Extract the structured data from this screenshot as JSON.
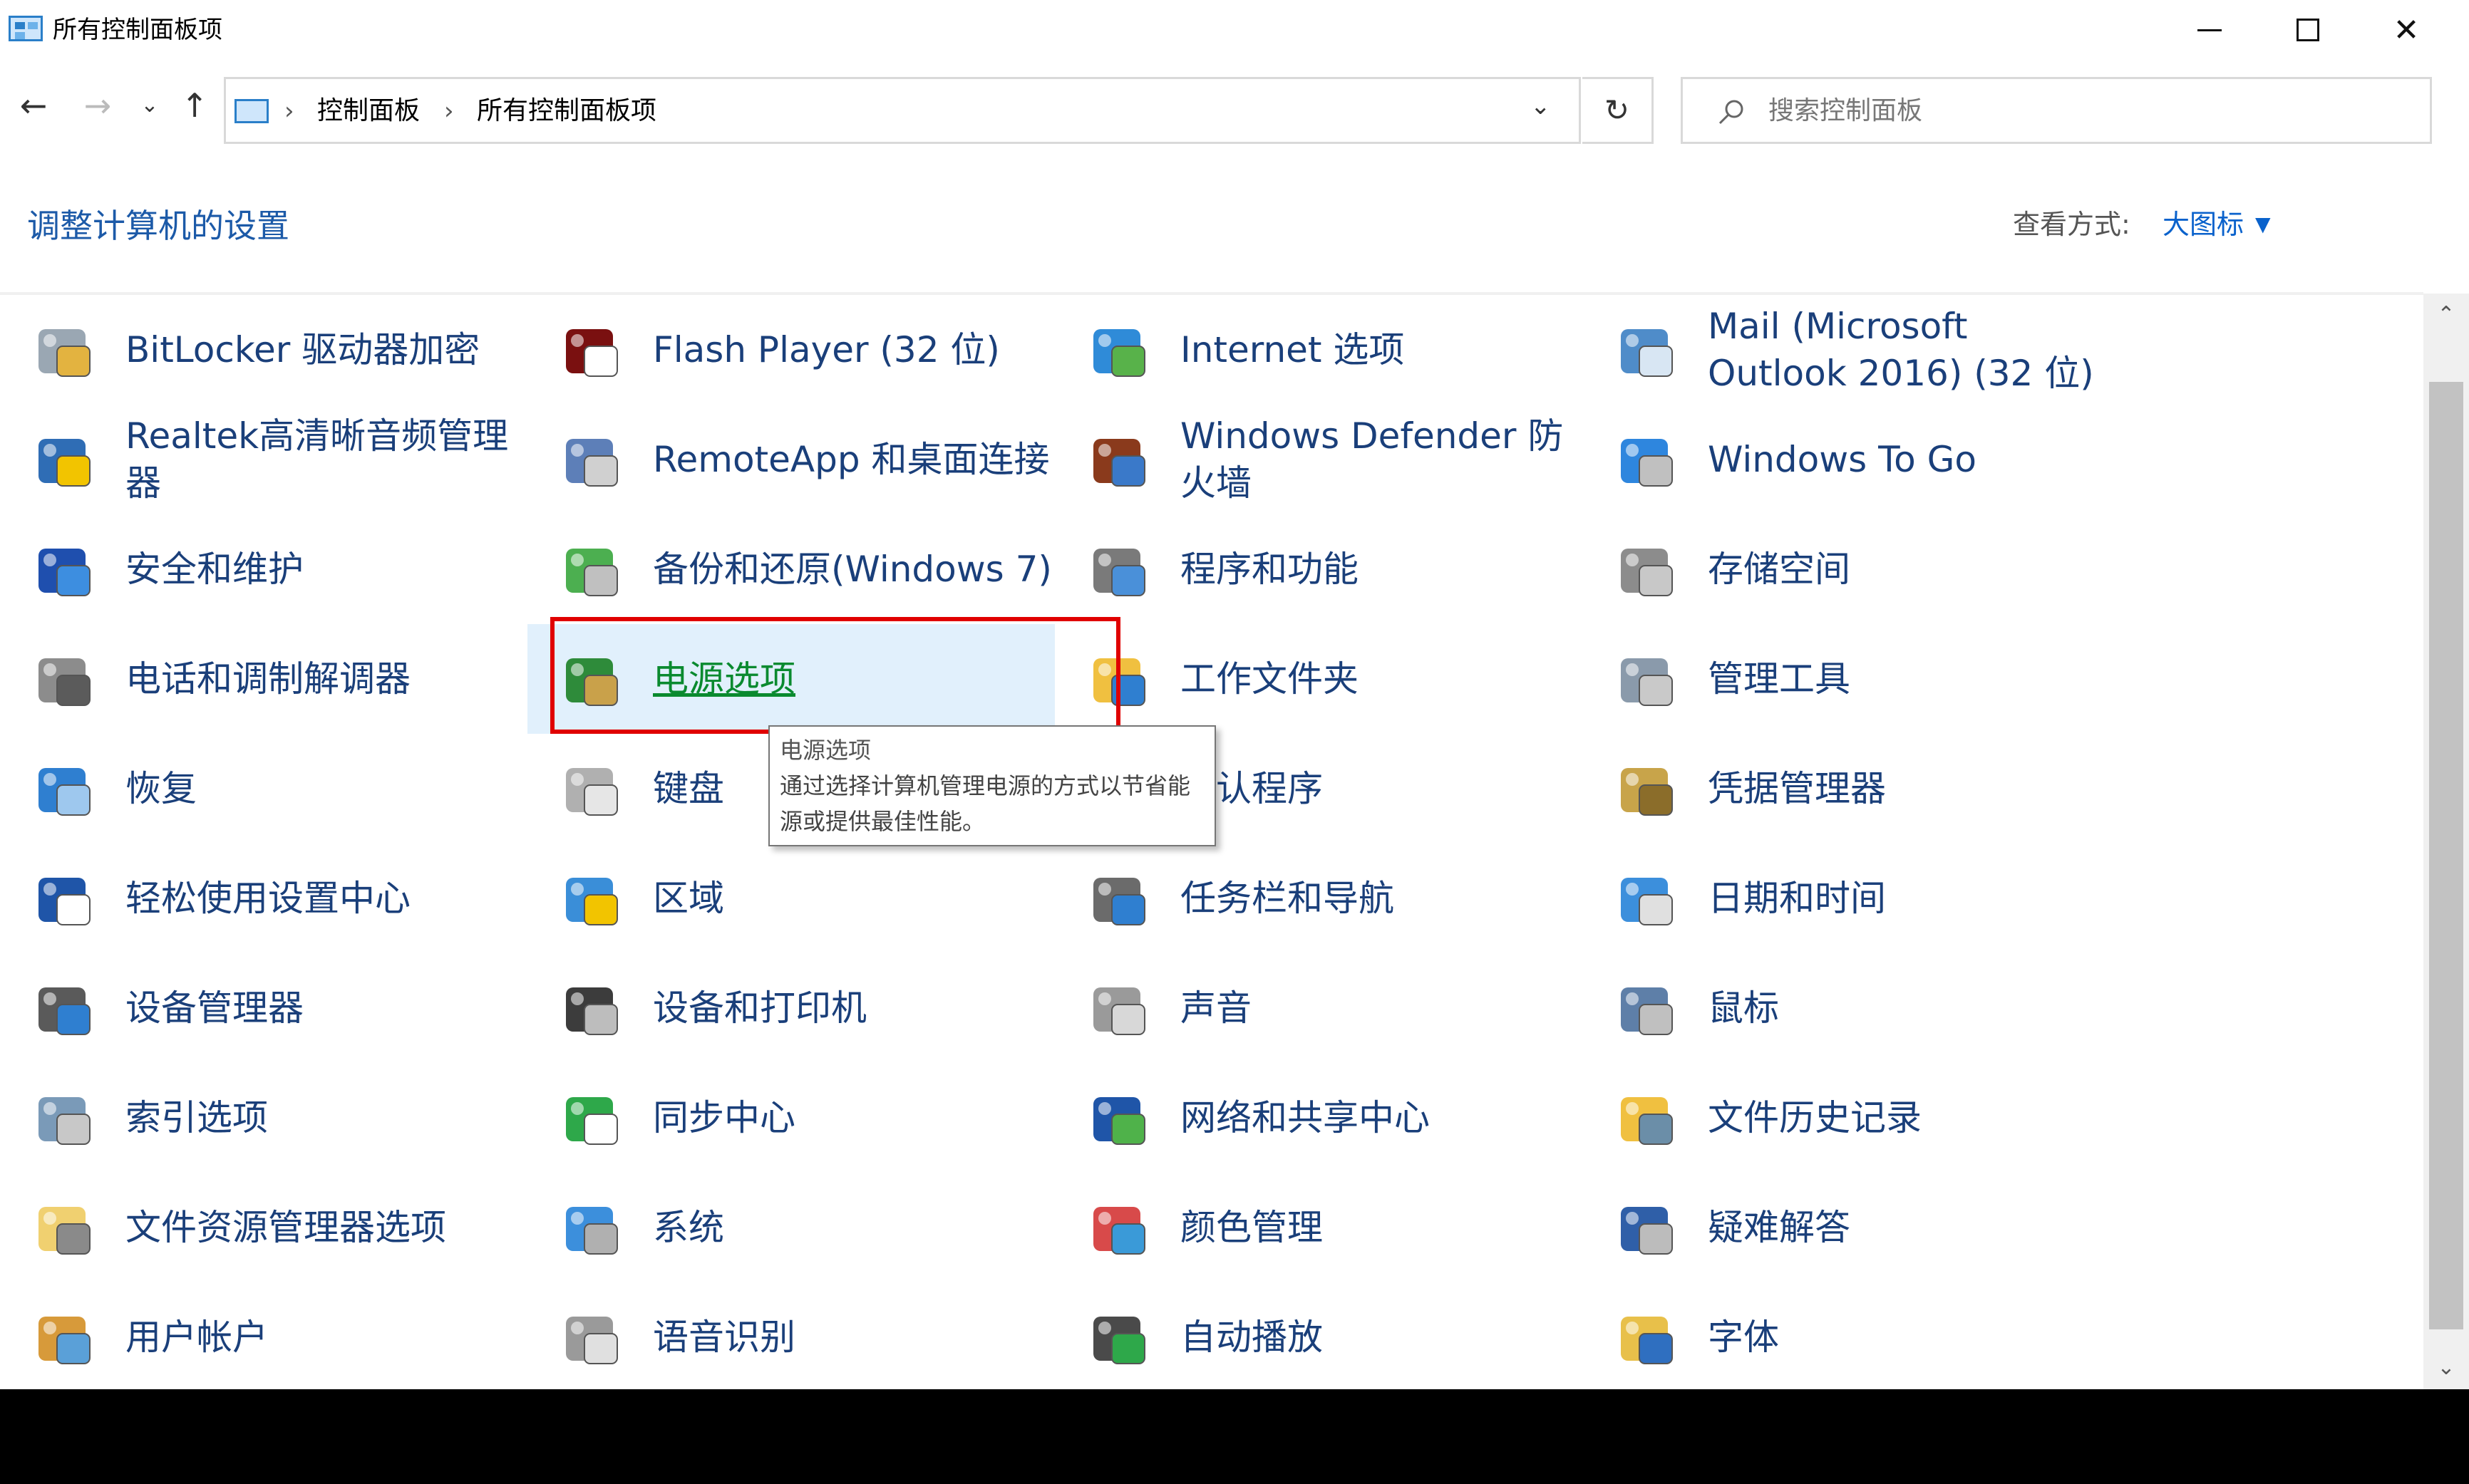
{
  "window": {
    "title": "所有控制面板项"
  },
  "nav": {
    "back": "←",
    "forward": "→",
    "recent": "⌄",
    "up": "↑",
    "breadcrumb": [
      "控制面板",
      "所有控制面板项"
    ],
    "separator": "›",
    "dropdown": "⌄",
    "refresh": "↻",
    "search_placeholder": "搜索控制面板"
  },
  "header": {
    "title": "调整计算机的设置",
    "view_by_label": "查看方式:",
    "view_by_value": "大图标",
    "view_by_caret": "▼"
  },
  "items": [
    {
      "label": "BitLocker 驱动器加密",
      "icon": "bitlocker-icon"
    },
    {
      "label": "Flash Player (32 位)",
      "icon": "flash-player-icon"
    },
    {
      "label": "Internet 选项",
      "icon": "internet-options-icon"
    },
    {
      "label": "Mail (Microsoft Outlook 2016) (32 位)",
      "icon": "mail-icon"
    },
    {
      "label": "Realtek高清晰音频管理器",
      "icon": "realtek-audio-icon"
    },
    {
      "label": "RemoteApp 和桌面连接",
      "icon": "remoteapp-icon"
    },
    {
      "label": "Windows Defender 防火墙",
      "icon": "firewall-icon"
    },
    {
      "label": "Windows To Go",
      "icon": "windows-to-go-icon"
    },
    {
      "label": "安全和维护",
      "icon": "security-flag-icon"
    },
    {
      "label": "备份和还原(Windows 7)",
      "icon": "backup-restore-icon"
    },
    {
      "label": "程序和功能",
      "icon": "programs-features-icon"
    },
    {
      "label": "存储空间",
      "icon": "storage-spaces-icon"
    },
    {
      "label": "电话和调制解调器",
      "icon": "phone-modem-icon"
    },
    {
      "label": "电源选项",
      "icon": "power-options-icon"
    },
    {
      "label": "工作文件夹",
      "icon": "work-folders-icon"
    },
    {
      "label": "管理工具",
      "icon": "admin-tools-icon"
    },
    {
      "label": "恢复",
      "icon": "recovery-icon"
    },
    {
      "label": "键盘",
      "icon": "keyboard-icon"
    },
    {
      "label": "默认程序",
      "icon": "default-programs-icon"
    },
    {
      "label": "凭据管理器",
      "icon": "credential-manager-icon"
    },
    {
      "label": "轻松使用设置中心",
      "icon": "ease-of-access-icon"
    },
    {
      "label": "区域",
      "icon": "region-icon"
    },
    {
      "label": "任务栏和导航",
      "icon": "taskbar-icon"
    },
    {
      "label": "日期和时间",
      "icon": "date-time-icon"
    },
    {
      "label": "设备管理器",
      "icon": "device-manager-icon"
    },
    {
      "label": "设备和打印机",
      "icon": "devices-printers-icon"
    },
    {
      "label": "声音",
      "icon": "sound-icon"
    },
    {
      "label": "鼠标",
      "icon": "mouse-icon"
    },
    {
      "label": "索引选项",
      "icon": "indexing-icon"
    },
    {
      "label": "同步中心",
      "icon": "sync-center-icon"
    },
    {
      "label": "网络和共享中心",
      "icon": "network-sharing-icon"
    },
    {
      "label": "文件历史记录",
      "icon": "file-history-icon"
    },
    {
      "label": "文件资源管理器选项",
      "icon": "explorer-options-icon"
    },
    {
      "label": "系统",
      "icon": "system-icon"
    },
    {
      "label": "颜色管理",
      "icon": "color-management-icon"
    },
    {
      "label": "疑难解答",
      "icon": "troubleshooting-icon"
    },
    {
      "label": "用户帐户",
      "icon": "user-accounts-icon"
    },
    {
      "label": "语音识别",
      "icon": "speech-recognition-icon"
    },
    {
      "label": "自动播放",
      "icon": "autoplay-icon"
    },
    {
      "label": "字体",
      "icon": "fonts-icon"
    }
  ],
  "hovered_item": "电源选项",
  "tooltip": {
    "title": "电源选项",
    "description": "通过选择计算机管理电源的方式以节省能源或提供最佳性能。"
  },
  "colors": {
    "link": "#1a3f7a",
    "title": "#1c5aa8",
    "hover_bg": "#e1f0fc",
    "highlight": "#e00000"
  }
}
